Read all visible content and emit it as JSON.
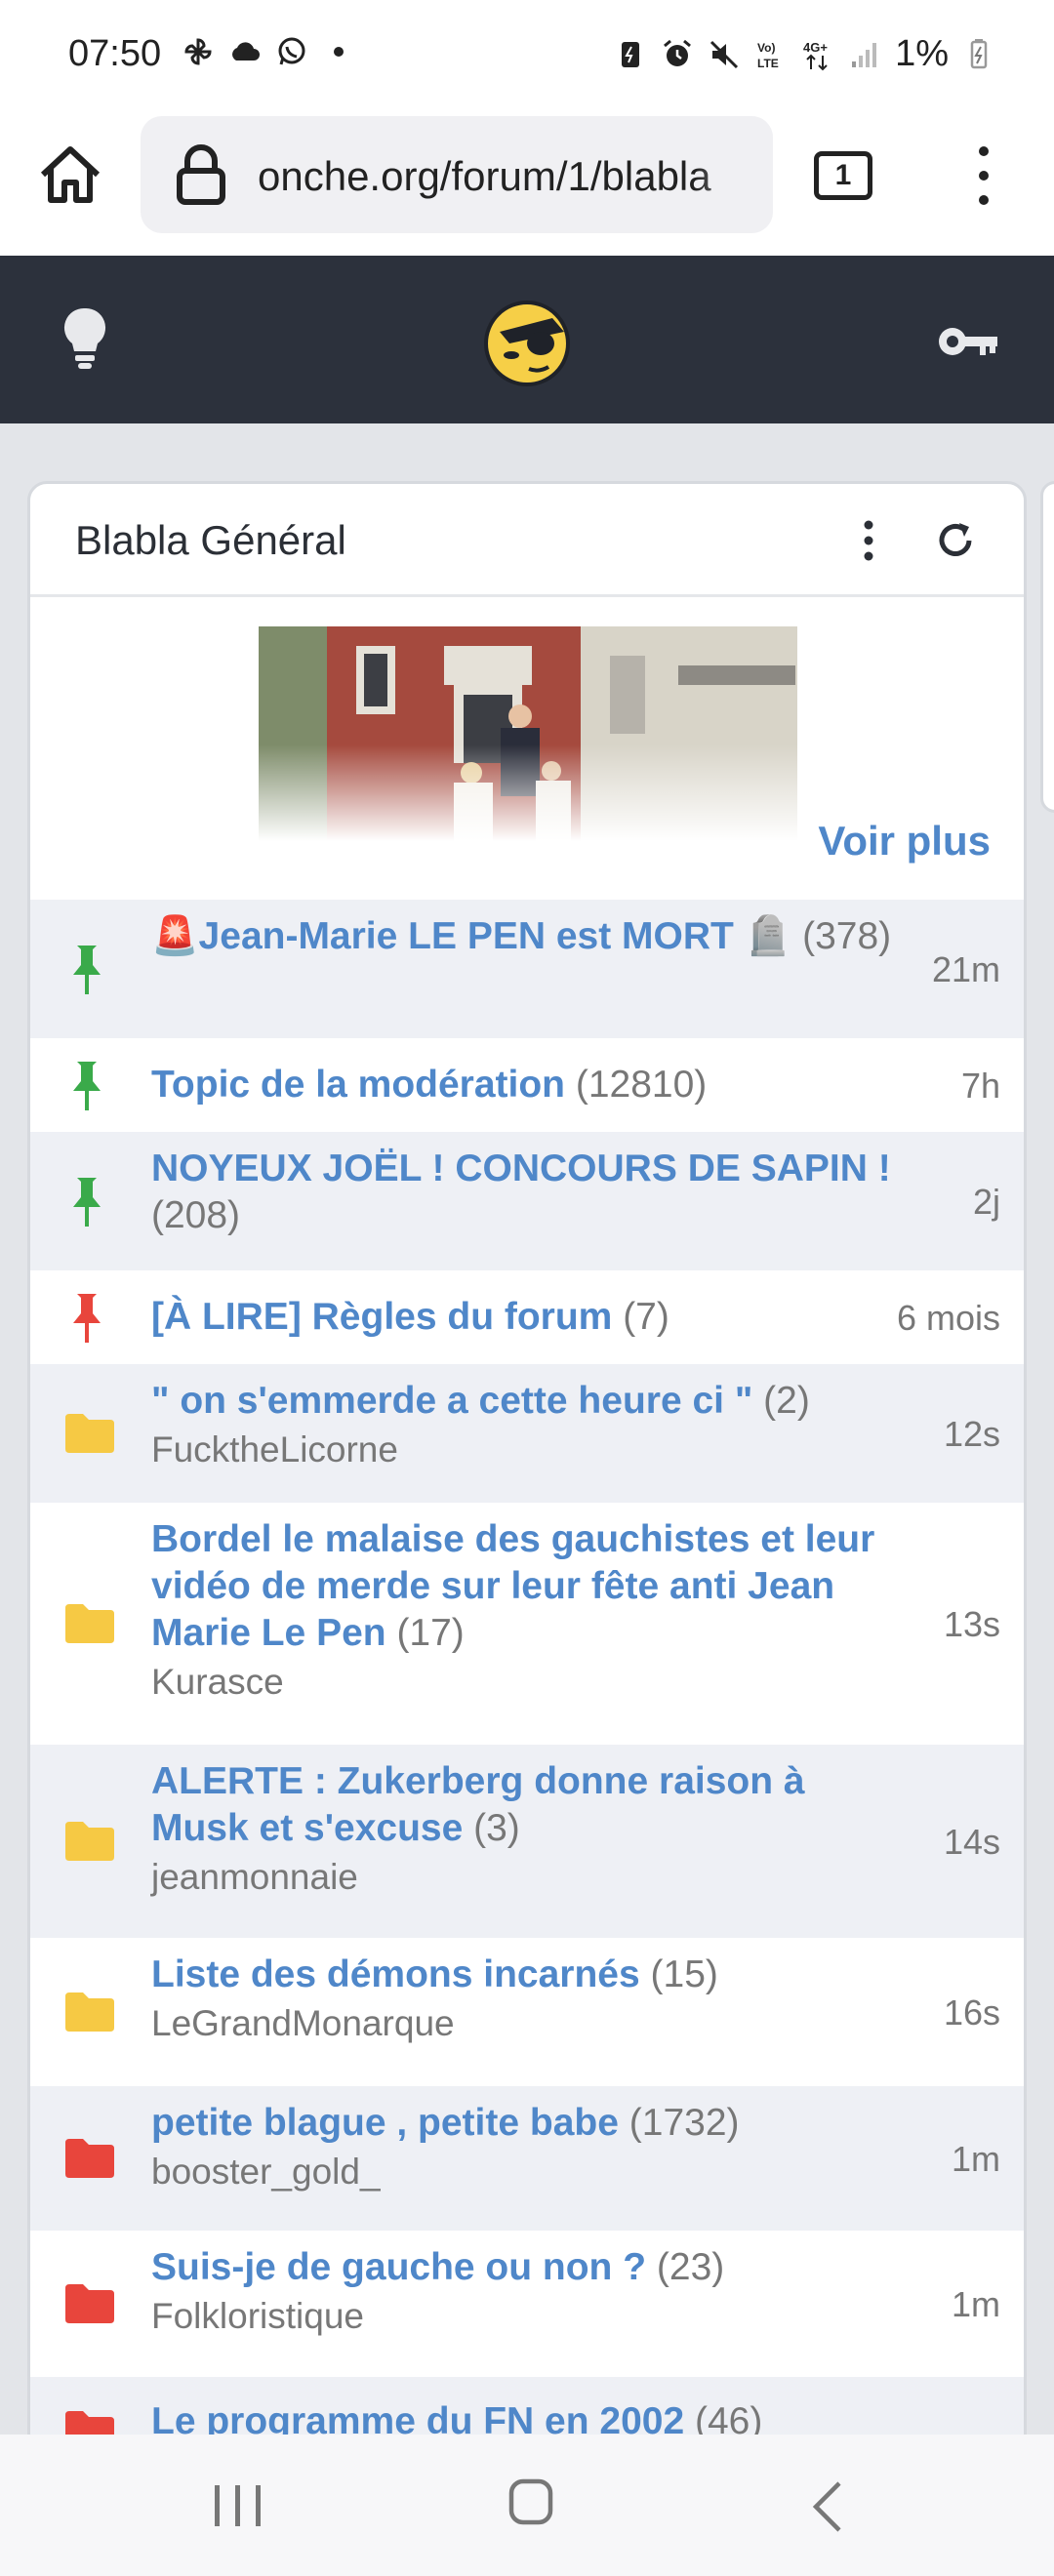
{
  "status": {
    "time": "07:50",
    "battery": "1%",
    "icons": [
      "pinwheel-icon",
      "cloud-icon",
      "whatsapp-icon",
      "dot-icon",
      "battery-saver-icon",
      "alarm-icon",
      "mute-icon",
      "volte-icon",
      "4g-icon",
      "signal-icon",
      "battery-icon"
    ]
  },
  "browser": {
    "url": "onche.org/forum/1/blabla",
    "tabs_count": "1"
  },
  "forum": {
    "title": "Blabla Général",
    "voir_plus": "Voir plus",
    "topics": [
      {
        "pin": "green",
        "title": "🚨Jean-Marie LE PEN est MORT 🪦",
        "count": "(378)",
        "author": "",
        "time": "21m",
        "alt": true
      },
      {
        "pin": "green",
        "title": "Topic de la modération",
        "count": "(12810)",
        "author": "",
        "time": "7h",
        "alt": false
      },
      {
        "pin": "green",
        "title": "NOYEUX JOËL ! CONCOURS DE SAPIN !",
        "count": "(208)",
        "author": "",
        "time": "2j",
        "alt": true
      },
      {
        "pin": "red",
        "title": "[À LIRE] Règles du forum",
        "count": "(7)",
        "author": "",
        "time": "6 mois",
        "alt": false
      },
      {
        "folder": "yellow",
        "title": "\" on s'emmerde a cette heure ci \"",
        "count": "(2)",
        "author": "FucktheLicorne",
        "time": "12s",
        "alt": true
      },
      {
        "folder": "yellow",
        "title": "Bordel le malaise des gauchistes et leur vidéo de merde sur leur fête anti Jean Marie Le Pen",
        "count": "(17)",
        "author": "Kurasce",
        "time": "13s",
        "alt": false
      },
      {
        "folder": "yellow",
        "title": "ALERTE : Zukerberg donne raison à Musk et s'excuse",
        "count": "(3)",
        "author": "jeanmonnaie",
        "time": "14s",
        "alt": true
      },
      {
        "folder": "yellow",
        "title": "Liste des démons incarnés",
        "count": "(15)",
        "author": "LeGrandMonarque",
        "time": "16s",
        "alt": false
      },
      {
        "folder": "red",
        "title": "petite blague , petite babe",
        "count": "(1732)",
        "author": "booster_gold_",
        "time": "1m",
        "alt": true
      },
      {
        "folder": "red",
        "title": "Suis-je de gauche ou non ?",
        "count": "(23)",
        "author": "Folkloristique",
        "time": "1m",
        "alt": false
      },
      {
        "folder": "red",
        "title": "Le programme du FN en 2002",
        "count": "(46)",
        "author": "",
        "time": "",
        "alt": true
      }
    ]
  },
  "colors": {
    "header_bg": "#2c313c",
    "link": "#4f87c9",
    "pin_green": "#3aaa4a",
    "pin_red": "#e8453c",
    "folder_yellow": "#f6c944",
    "folder_red": "#e8453c"
  }
}
